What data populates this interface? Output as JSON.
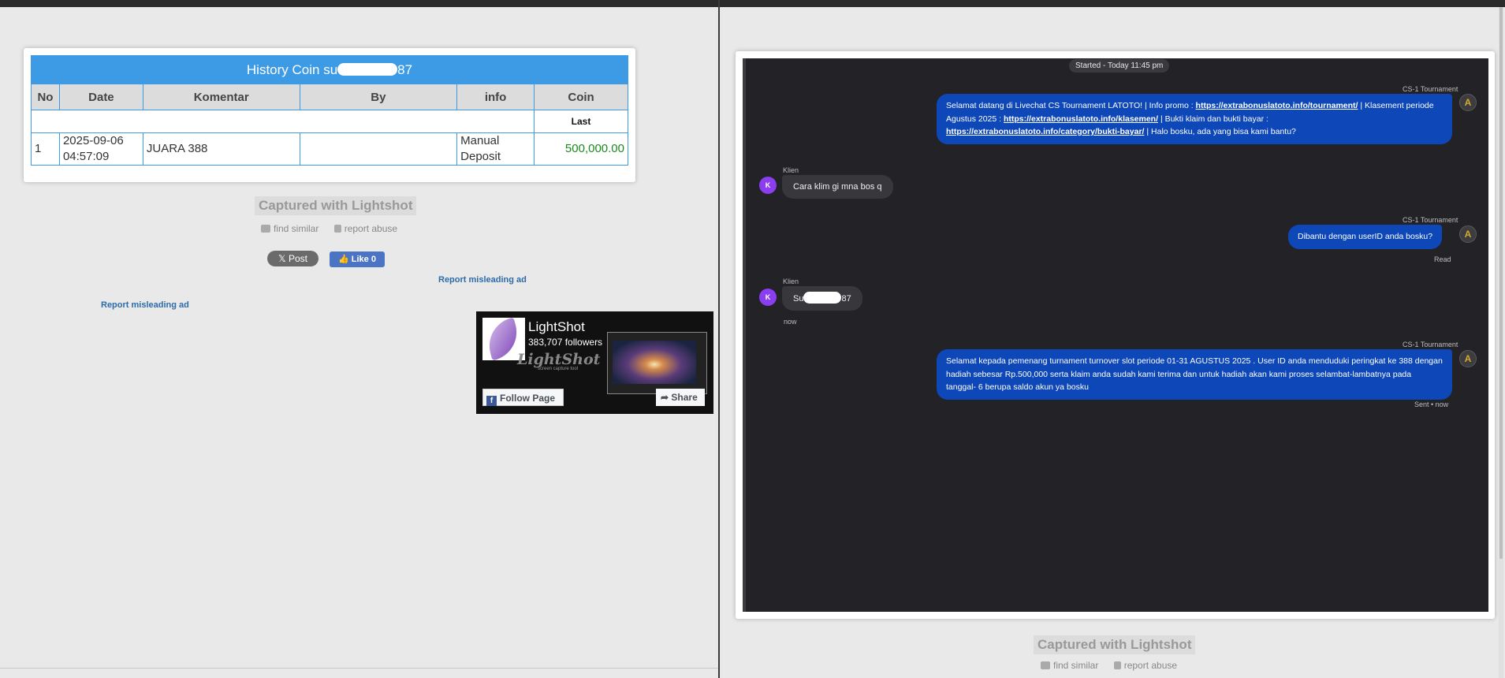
{
  "left": {
    "table": {
      "title_prefix": "History Coin su",
      "title_suffix": "87",
      "headers": [
        "No",
        "Date",
        "Komentar",
        "By",
        "info",
        "Coin"
      ],
      "sub_label": "Last",
      "rows": [
        {
          "no": "1",
          "date_line1": "2025-09-06",
          "date_line2": "04:57:09",
          "komentar": "JUARA 388",
          "by": "",
          "info_line1": "Manual",
          "info_line2": "Deposit",
          "coin": "500,000.00"
        }
      ]
    },
    "captured_label": "Captured with Lightshot",
    "find_similar": "find similar",
    "report_abuse": "report abuse",
    "x_post": "Post",
    "fb_like": "Like 0",
    "report_ad_1": "Report misleading ad",
    "report_ad_2": "Report misleading ad",
    "fb_widget": {
      "name": "LightShot",
      "followers": "383,707 followers",
      "logo_text": "LightShot",
      "logo_sub": "screen capture tool",
      "follow_label": "Follow Page",
      "share_label": "Share"
    }
  },
  "right": {
    "chat": {
      "started": "Started - Today 11:45 pm",
      "agent_name": "CS-1 Tournament",
      "client_name": "Klien",
      "client_initial": "K",
      "msg1": {
        "part1": "Selamat datang di Livechat CS Tournament LATOTO! | Info promo :",
        "link1": "https://extrabonuslatoto.info/tournament/",
        "part2": "| Klasement periode Agustus 2025 :",
        "link2": "https://extrabonuslatoto.info/klasemen/",
        "part3": "| Bukti klaim dan bukti bayar :",
        "link3": "https://extrabonuslatoto.info/category/bukti-bayar/",
        "part4": "| Halo bosku, ada yang bisa kami bantu?"
      },
      "msg2": "Cara klim gi mna bos q",
      "msg3": "Dibantu dengan userID anda bosku?",
      "msg3_status": "Read",
      "msg4_prefix": "Su",
      "msg4_suffix": "87",
      "msg4_time": "now",
      "msg5": "Selamat kepada pemenang turnament turnover slot periode 01-31 AGUSTUS 2025 . User ID anda menduduki peringkat ke 388 dengan hadiah sebesar Rp.500,000 serta klaim anda sudah kami terima dan untuk hadiah akan kami proses selambat-lambatnya pada tanggal- 6 berupa saldo akun ya bosku",
      "msg5_status": "Sent • now"
    },
    "captured_label": "Captured with Lightshot",
    "find_similar": "find similar",
    "report_abuse": "report abuse"
  }
}
